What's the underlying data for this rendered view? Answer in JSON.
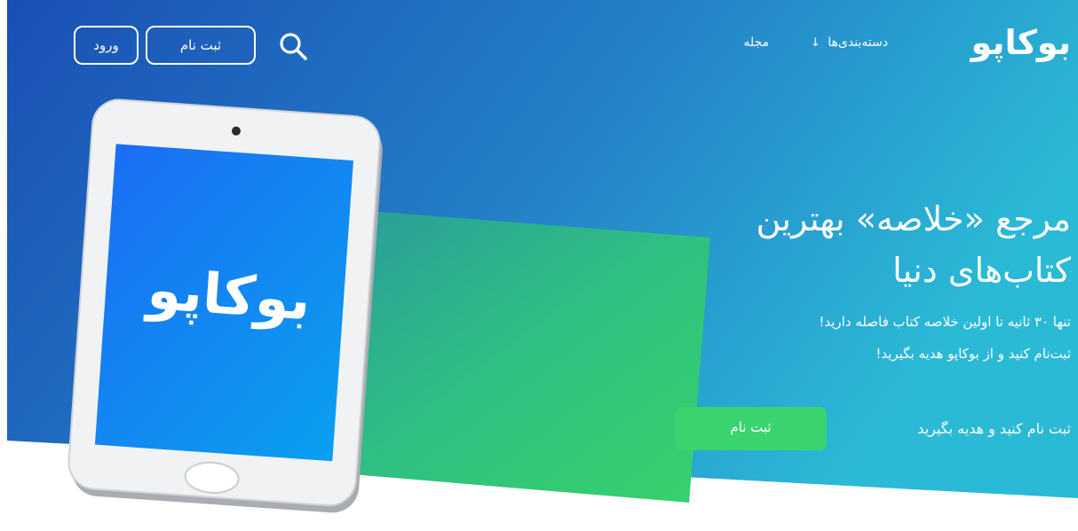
{
  "header": {
    "logo": "بوکاپو",
    "nav": {
      "categories_label": "دسته‌بندی‌ها",
      "categories_arrow": "↓",
      "magazine_label": "مجله"
    },
    "signup_label": "ثبت نام",
    "login_label": "ورود",
    "search_icon": "search-icon"
  },
  "hero": {
    "tablet_logo": "بوکاپو",
    "headline_line1": "مرجع «خلاصه» بهترین",
    "headline_line2": "کتاب‌های دنیا",
    "subline_line1": "تنها ۳۰ ثانیه تا اولین خلاصه کتاب فاصله دارید!",
    "subline_line2": "ثبت‌نام کنید و از بوکاپو هدیه بگیرید!",
    "cta_text": "ثبت نام کنید و هدیه بگیرید",
    "cta_button": "ثبت نام"
  },
  "colors": {
    "gradient_start": "#1a57b8",
    "gradient_end": "#2cb2d6",
    "green_panel": "#33c970",
    "screen_blue": "#1f7ff0",
    "cta_green": "#3ad36e"
  }
}
